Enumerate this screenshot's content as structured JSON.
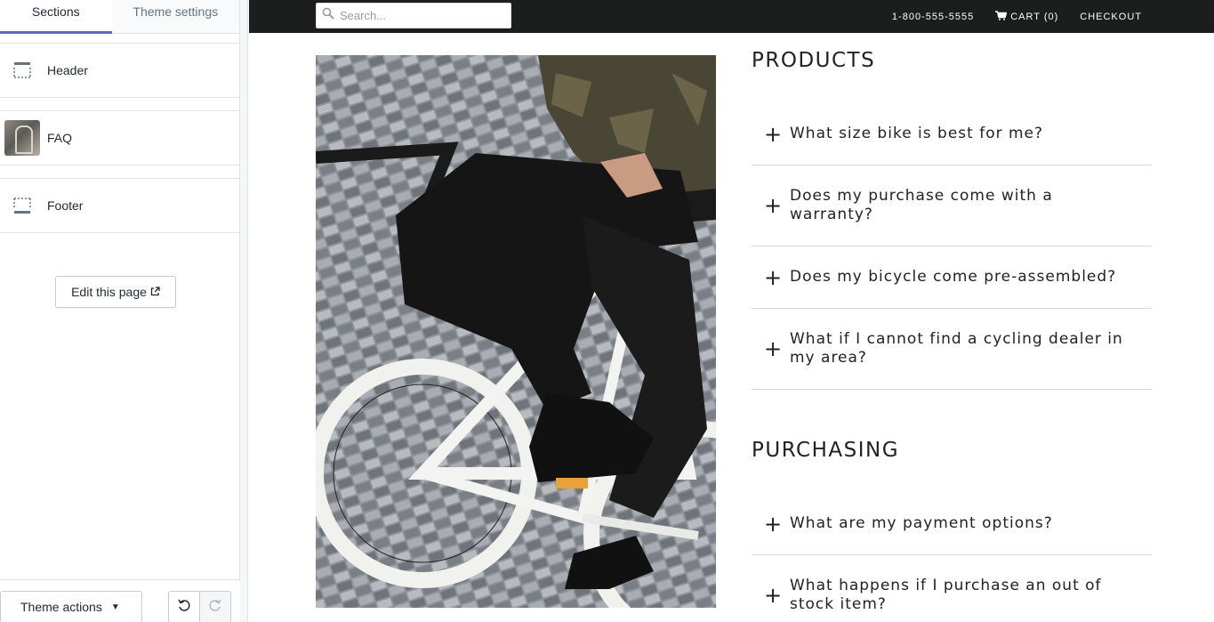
{
  "sidebar": {
    "tabs": [
      "Sections",
      "Theme settings"
    ],
    "sections": [
      {
        "label": "Header",
        "icon": "header-layout-icon"
      },
      {
        "label": "FAQ",
        "icon": "bicycle-thumbnail"
      },
      {
        "label": "Footer",
        "icon": "footer-layout-icon"
      }
    ],
    "edit_button": "Edit this page",
    "theme_actions": "Theme actions"
  },
  "store": {
    "search_placeholder": "Search...",
    "phone": "1-800-555-5555",
    "cart": "CART (0)",
    "checkout": "CHECKOUT"
  },
  "faq": {
    "groups": [
      {
        "heading": "PRODUCTS",
        "items": [
          "What size bike is best for me?",
          "Does my purchase come with a warranty?",
          "Does my bicycle come pre-assembled?",
          "What if I cannot find a cycling dealer in my area?"
        ]
      },
      {
        "heading": "PURCHASING",
        "items": [
          "What are my payment options?",
          "What happens if I purchase an out of stock item?"
        ]
      }
    ]
  },
  "colors": {
    "accent": "#5c6ac4",
    "topbar": "#1c1d1d"
  }
}
